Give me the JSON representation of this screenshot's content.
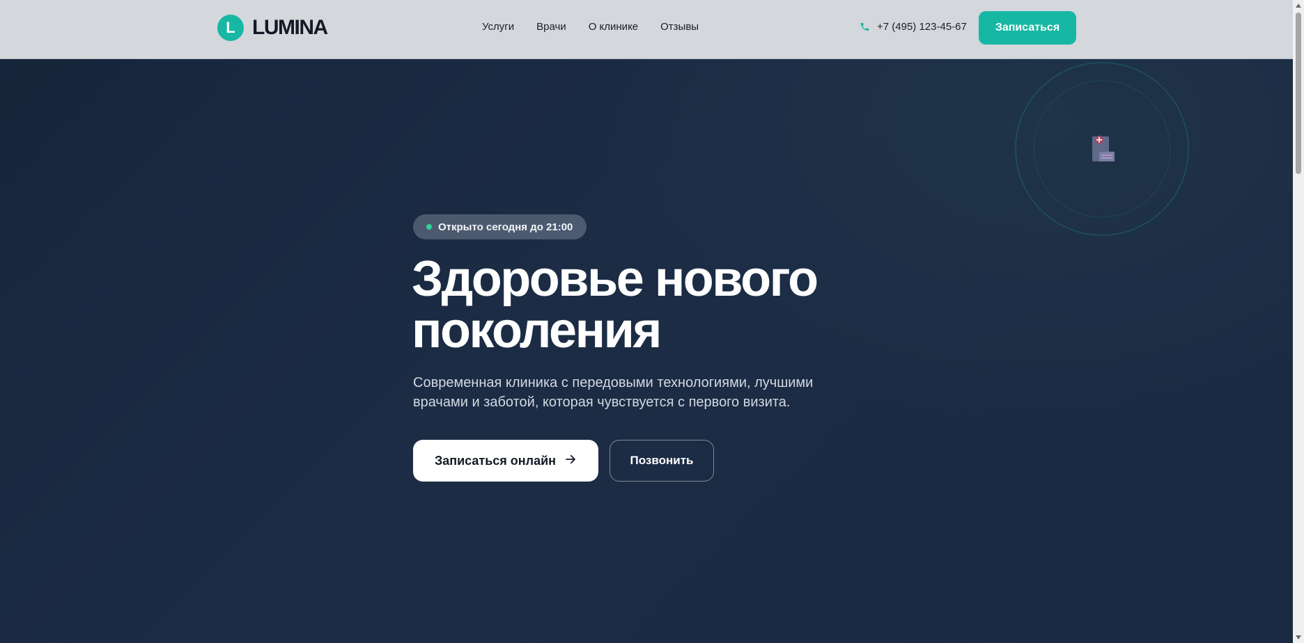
{
  "header": {
    "logo_letter": "L",
    "logo_text": "LUMINA",
    "nav": [
      {
        "label": "Услуги"
      },
      {
        "label": "Врачи"
      },
      {
        "label": "О клинике"
      },
      {
        "label": "Отзывы"
      }
    ],
    "phone": "+7 (495) 123-45-67",
    "cta_label": "Записаться"
  },
  "hero": {
    "badge": "Открыто сегодня до 21:00",
    "title_line1": "Здоровье нового",
    "title_line2": "поколения",
    "subtitle": "Современная клиника с передовыми технологиями, лучшими врачами и заботой, которая чувствуется с первого визита.",
    "primary_button": "Записаться онлайн",
    "secondary_button": "Позвонить"
  },
  "icons": {
    "phone": "phone-icon",
    "arrow": "arrow-right-icon",
    "hospital": "hospital-icon"
  },
  "colors": {
    "accent": "#17b8a3",
    "header_bg": "#d4d7dc",
    "hero_bg": "#1a2940",
    "status_dot": "#2fd39e"
  }
}
